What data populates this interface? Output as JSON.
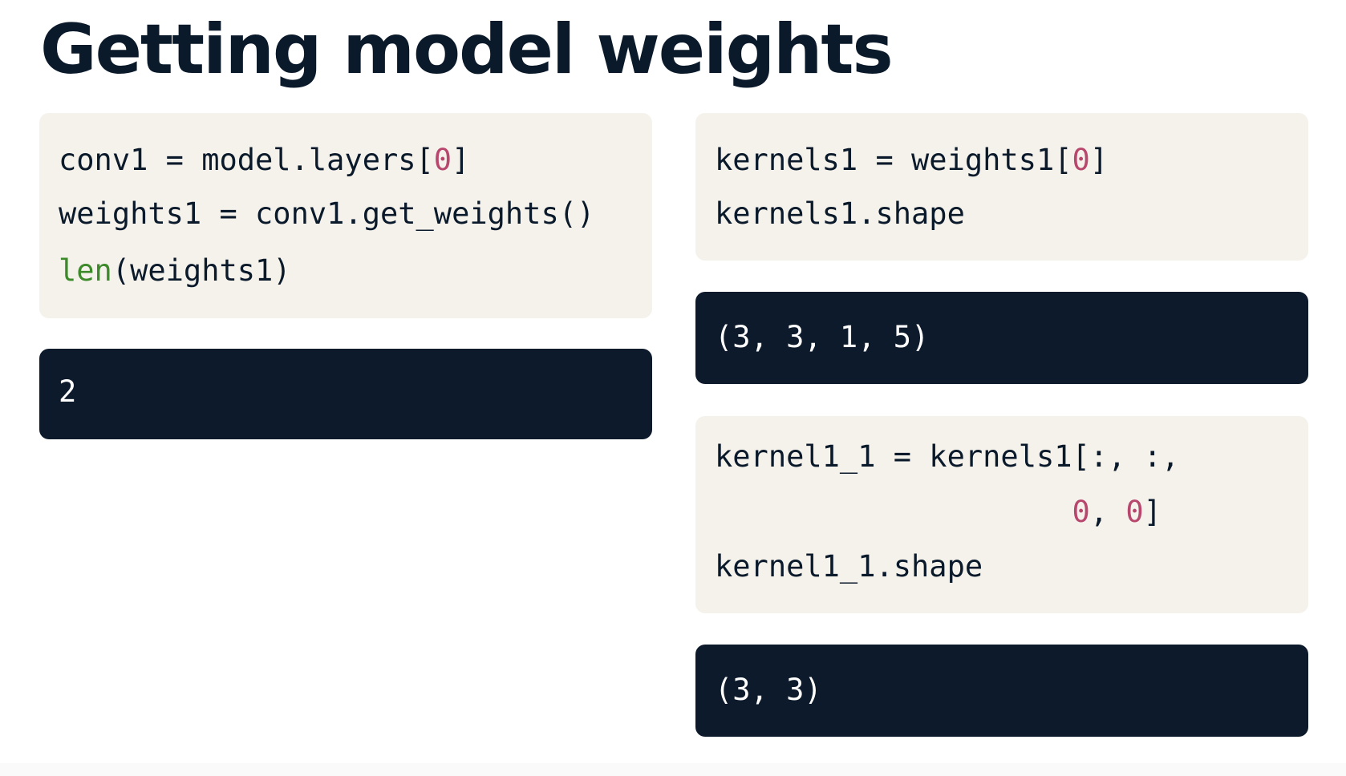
{
  "title": "Getting model weights",
  "colors": {
    "code_bg": "#f5f2ec",
    "output_bg": "#0c1a2b",
    "text_dark": "#0b1a2b",
    "number": "#b8476e",
    "builtin": "#3c8a2a"
  },
  "left": {
    "code": {
      "line1": {
        "a": "conv1 = model.layers[",
        "num": "0",
        "b": "]"
      },
      "line2": "weights1 = conv1.get_weights()",
      "line3": {
        "builtin": "len",
        "rest": "(weights1)"
      }
    },
    "output": "2"
  },
  "right": {
    "code1": {
      "line1": {
        "a": "kernels1 = weights1[",
        "num": "0",
        "b": "]"
      },
      "line2": "kernels1.shape"
    },
    "output1": "(3, 3, 1, 5)",
    "code2": {
      "line1": "kernel1_1 = kernels1[:, :,",
      "line2": {
        "indent": "                    ",
        "num1": "0",
        "sep": ", ",
        "num2": "0",
        "b": "]"
      },
      "line3": "kernel1_1.shape"
    },
    "output2": "(3, 3)"
  }
}
